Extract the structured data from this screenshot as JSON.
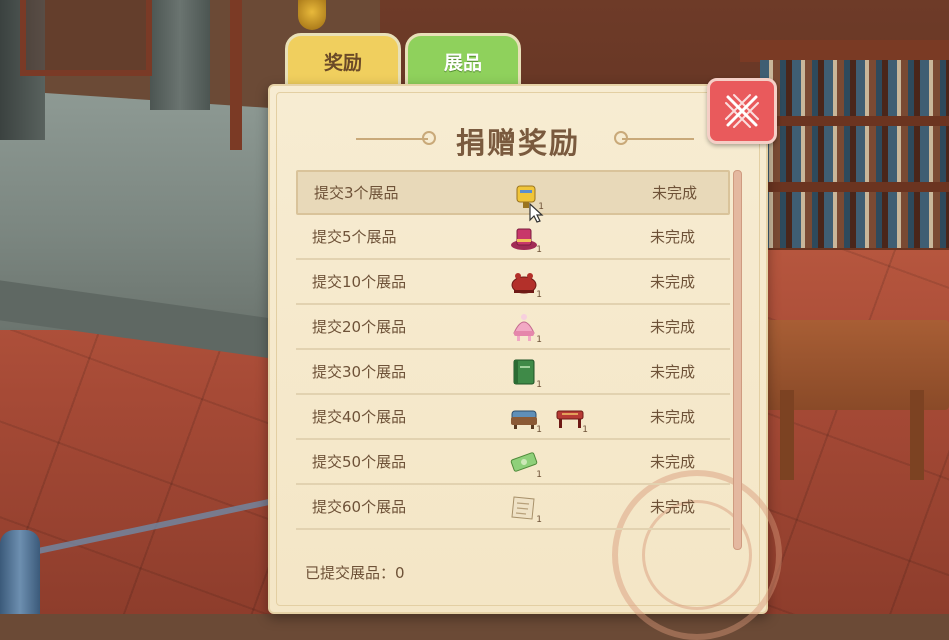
{
  "tabs": [
    {
      "label": "奖励"
    },
    {
      "label": "展品"
    }
  ],
  "panel": {
    "title": "捐赠奖励",
    "footer_label": "已提交展品：0"
  },
  "rows": [
    {
      "label": "提交3个展品",
      "status": "未完成",
      "items": [
        {
          "icon": "yellow-mailbox-icon",
          "count": "1"
        }
      ]
    },
    {
      "label": "提交5个展品",
      "status": "未完成",
      "items": [
        {
          "icon": "magenta-top-hat-icon",
          "count": "1"
        }
      ]
    },
    {
      "label": "提交10个展品",
      "status": "未完成",
      "items": [
        {
          "icon": "red-crab-furniture-icon",
          "count": "1"
        }
      ]
    },
    {
      "label": "提交20个展品",
      "status": "未完成",
      "items": [
        {
          "icon": "pink-knit-hat-icon",
          "count": "1"
        }
      ]
    },
    {
      "label": "提交30个展品",
      "status": "未完成",
      "items": [
        {
          "icon": "green-book-icon",
          "count": "1"
        }
      ]
    },
    {
      "label": "提交40个展品",
      "status": "未完成",
      "items": [
        {
          "icon": "blue-sofa-icon",
          "count": "1"
        },
        {
          "icon": "red-table-icon",
          "count": "1"
        }
      ]
    },
    {
      "label": "提交50个展品",
      "status": "未完成",
      "items": [
        {
          "icon": "green-banknote-icon",
          "count": "1"
        }
      ]
    },
    {
      "label": "提交60个展品",
      "status": "未完成",
      "items": [
        {
          "icon": "paper-scroll-icon",
          "count": "1"
        }
      ]
    }
  ],
  "colors": {
    "tab_rewards": "#f0cf5e",
    "tab_exhibits": "#8fd15c",
    "panel_bg": "#f4e6c6",
    "close_button": "#e95a5c",
    "text": "#6e5238"
  }
}
